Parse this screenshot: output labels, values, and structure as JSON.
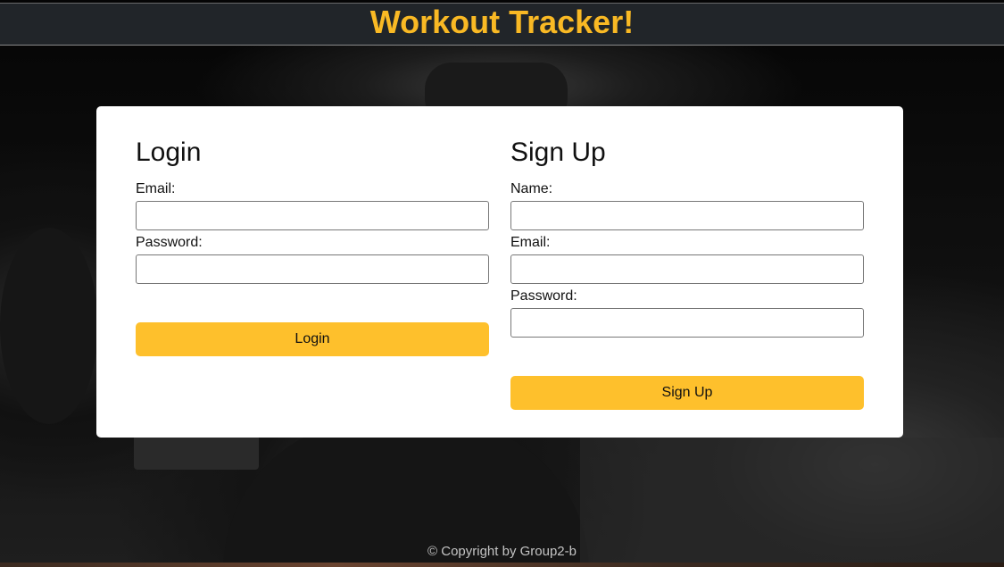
{
  "header": {
    "title": "Workout Tracker!"
  },
  "login": {
    "heading": "Login",
    "email_label": "Email:",
    "email_value": "",
    "password_label": "Password:",
    "password_value": "",
    "button_label": "Login"
  },
  "signup": {
    "heading": "Sign Up",
    "name_label": "Name:",
    "name_value": "",
    "email_label": "Email:",
    "email_value": "",
    "password_label": "Password:",
    "password_value": "",
    "button_label": "Sign Up"
  },
  "footer": {
    "copyright": "© Copyright by Group2-b"
  },
  "colors": {
    "accent": "#fec02c",
    "title": "#f9b924",
    "header_bg": "#212529"
  }
}
